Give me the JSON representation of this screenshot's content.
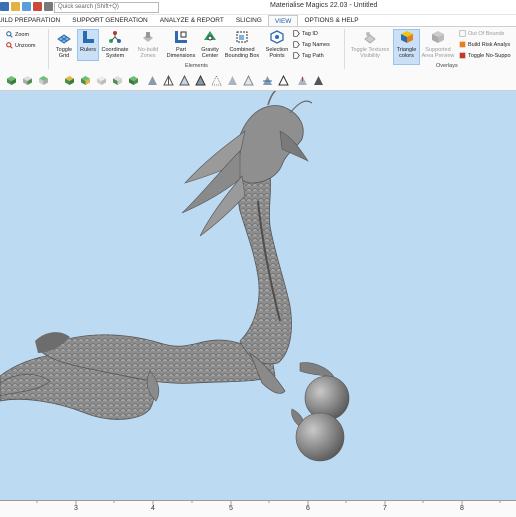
{
  "titlebar": {
    "search_placeholder": "Quick search (Shift+Q)",
    "app_title": "Materialise Magics 22.03 - Untitled"
  },
  "tabs": [
    {
      "label": "UILD PREPARATION"
    },
    {
      "label": "SUPPORT GENERATION"
    },
    {
      "label": "ANALYZE & REPORT"
    },
    {
      "label": "SLICING"
    },
    {
      "label": "VIEW",
      "active": true
    },
    {
      "label": "OPTIONS & HELP"
    }
  ],
  "ribbon": {
    "zoom": "Zoom",
    "unzoom": "Unzoom",
    "toggle_grid": "Toggle\nGrid",
    "rulers": "Rulers",
    "coordinate_system": "Coordinate\nSystem",
    "no_build_zones": "No-build\nZones",
    "part_dimensions": "Part\nDimensions",
    "gravity_center": "Gravity\nCenter",
    "combined_bounding_box": "Combined\nBounding Box",
    "selection_points": "Selection\nPoints",
    "tag_id": "Tag ID",
    "tag_names": "Tag Names",
    "tag_path": "Tag Path",
    "elements_group": "Elements",
    "toggle_textures_visibility": "Toggle Textures\nVisibility",
    "triangle_colors": "Triangle\ncolors",
    "supported_area_preview": "Supported\nArea Preview",
    "out_of_bounds": "Out Of Bounds",
    "build_risk_analysis": "Build Risk Analys",
    "toggle_no_support": "Toggle No-Suppo",
    "overlays_group": "Overlays"
  },
  "ruler": {
    "ticks": [
      "3",
      "4",
      "5",
      "6",
      "7",
      "8"
    ]
  },
  "colors": {
    "viewport_bg": "#bddaf3",
    "accent": "#1d5fae",
    "model": "#8a8a8a"
  }
}
